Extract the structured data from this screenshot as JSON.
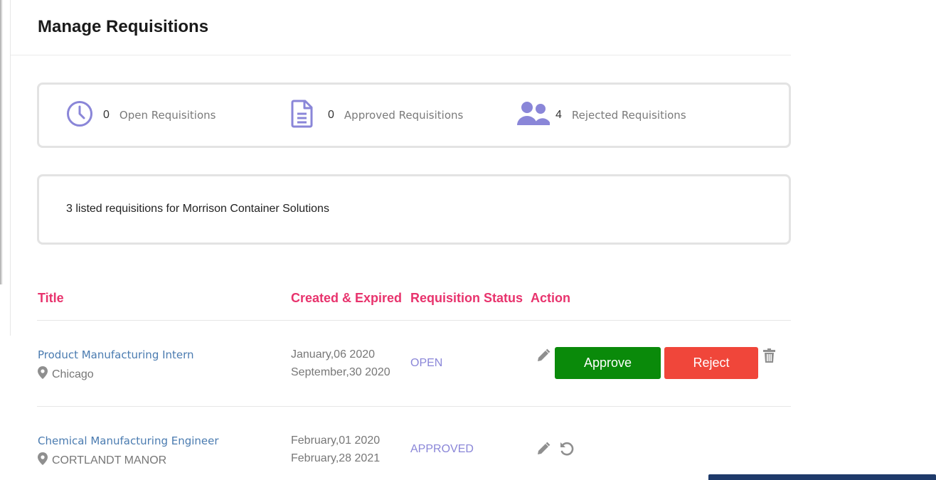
{
  "page": {
    "title": "Manage Requisitions"
  },
  "stats": [
    {
      "icon": "clock-icon",
      "count": "0",
      "label": "Open Requisitions"
    },
    {
      "icon": "document-icon",
      "count": "0",
      "label": "Approved Requisitions"
    },
    {
      "icon": "users-icon",
      "count": "4",
      "label": "Rejected Requisitions"
    }
  ],
  "summary": {
    "text": "3 listed requisitions for Morrison Container Solutions"
  },
  "table": {
    "headers": {
      "title": "Title",
      "dates": "Created & Expired",
      "status": "Requisition Status",
      "action": "Action"
    },
    "rows": [
      {
        "title": "Product Manufacturing Intern",
        "location": "Chicago",
        "created": "January,06 2020",
        "expired": "September,30 2020",
        "status": "OPEN",
        "approve_label": "Approve",
        "reject_label": "Reject"
      },
      {
        "title": "Chemical Manufacturing Engineer",
        "location": "CORTLANDT MANOR",
        "created": "February,01 2020",
        "expired": "February,28 2021",
        "status": "APPROVED"
      }
    ]
  },
  "colors": {
    "accent_pink": "#e8336d",
    "icon_purple": "#8a86d8",
    "link_blue": "#4a7bb0",
    "approve_green": "#0a8a0a",
    "reject_red": "#f0463a"
  }
}
